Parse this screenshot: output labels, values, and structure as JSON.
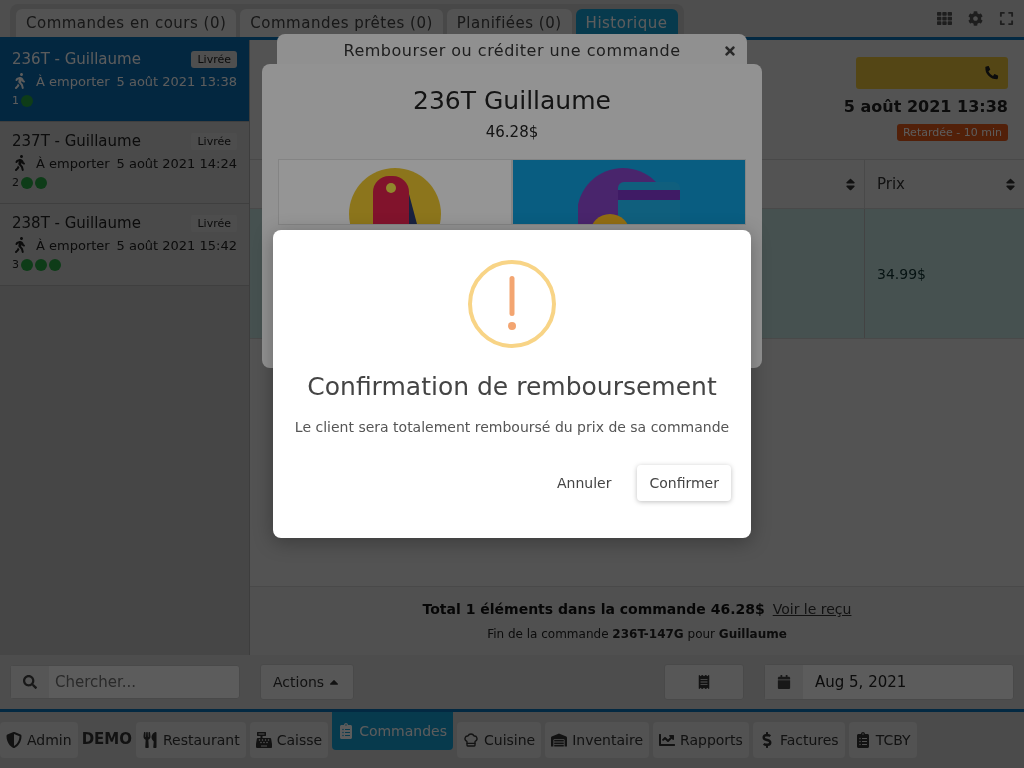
{
  "top_tabs": [
    {
      "label": "Commandes en cours (0)",
      "selected": false
    },
    {
      "label": "Commandes prêtes (0)",
      "selected": false
    },
    {
      "label": "Planifiées (0)",
      "selected": false
    },
    {
      "label": "Historique",
      "selected": true
    }
  ],
  "orders": [
    {
      "title": "236T - Guillaume",
      "status": "Livrée",
      "mode": "À emporter",
      "datetime": "5 août 2021 13:38",
      "count": "1",
      "selected": true
    },
    {
      "title": "237T - Guillaume",
      "status": "Livrée",
      "mode": "À emporter",
      "datetime": "5 août 2021 14:24",
      "count": "2",
      "selected": false
    },
    {
      "title": "238T - Guillaume",
      "status": "Livrée",
      "mode": "À emporter",
      "datetime": "5 août 2021 15:42",
      "count": "3",
      "selected": false
    }
  ],
  "order_header": {
    "date": "5 août 2021 13:38",
    "badge": "Retardée - 10 min"
  },
  "table": {
    "columns": [
      "Prix"
    ],
    "rows": [
      {
        "price": "34.99$"
      }
    ]
  },
  "summary": {
    "total": "Total 1 éléments dans la commande 46.28$",
    "link": "Voir le reçu",
    "footer": "Fin de la commande **236T-147G** pour **Guillaume**"
  },
  "search": {
    "placeholder": "Chercher..."
  },
  "actions_button": "Actions",
  "date_field": "Aug 5, 2021",
  "nav": [
    {
      "kind": "button",
      "label": "Admin",
      "selected": false
    },
    {
      "kind": "brand",
      "label": "DEMO"
    },
    {
      "kind": "button",
      "label": "Restaurant",
      "selected": false
    },
    {
      "kind": "button",
      "label": "Caisse",
      "selected": false
    },
    {
      "kind": "button",
      "label": "Commandes",
      "selected": true
    },
    {
      "kind": "button",
      "label": "Cuisine",
      "selected": false
    },
    {
      "kind": "button",
      "label": "Inventaire",
      "selected": false
    },
    {
      "kind": "button",
      "label": "Rapports",
      "selected": false
    },
    {
      "kind": "button",
      "label": "Factures",
      "selected": false
    },
    {
      "kind": "button",
      "label": "TCBY",
      "selected": false
    }
  ],
  "refund_modal": {
    "title": "Rembourser ou créditer une commande",
    "heading": "236T Guillaume",
    "amount": "46.28$"
  },
  "confirm_dialog": {
    "title": "Confirmation de remboursement",
    "message": "Le client sera totalement remboursé du prix de sa commande",
    "buttons": [
      {
        "label": "Annuler",
        "kind": "secondary"
      },
      {
        "label": "Confirmer",
        "kind": "primary"
      }
    ]
  }
}
